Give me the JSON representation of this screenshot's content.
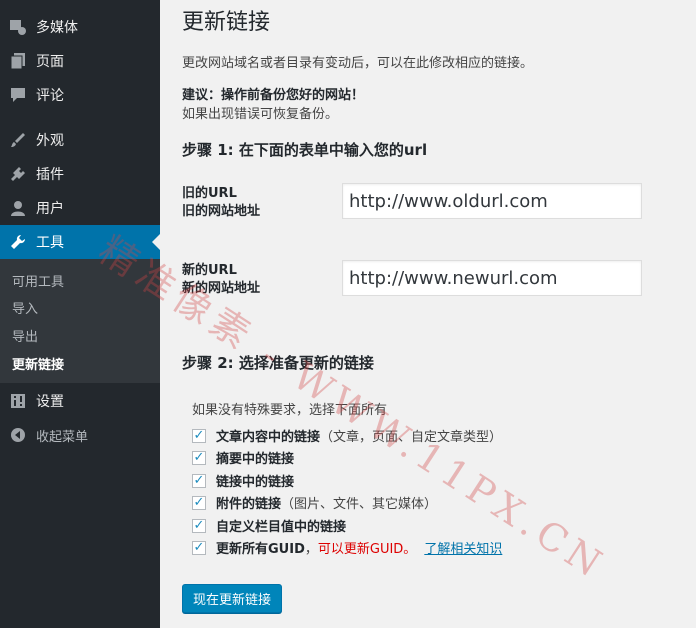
{
  "sidebar": {
    "items": [
      {
        "label": "多媒体",
        "icon": "media-icon"
      },
      {
        "label": "页面",
        "icon": "pages-icon"
      },
      {
        "label": "评论",
        "icon": "comments-icon"
      },
      {
        "label": "外观",
        "icon": "appearance-icon"
      },
      {
        "label": "插件",
        "icon": "plugins-icon"
      },
      {
        "label": "用户",
        "icon": "users-icon"
      },
      {
        "label": "工具",
        "icon": "tools-icon"
      }
    ],
    "submenu": [
      "可用工具",
      "导入",
      "导出",
      "更新链接"
    ],
    "bottom": [
      {
        "label": "设置",
        "icon": "settings-icon"
      },
      {
        "label": "收起菜单",
        "icon": "collapse-icon"
      }
    ]
  },
  "main": {
    "title": "更新链接",
    "description": "更改网站域名或者目录有变动后，可以在此修改相应的链接。",
    "suggestion": "建议：操作前备份您好的网站！",
    "suggestion_note": "如果出现错误可恢复备份。",
    "step1": "步骤 1: 在下面的表单中输入您的url",
    "old_label_1": "旧的URL",
    "old_label_2": "旧的网站地址",
    "old_value": "http://www.oldurl.com",
    "new_label_1": "新的URL",
    "new_label_2": "新的网站地址",
    "new_value": "http://www.newurl.com",
    "step2": "步骤 2: 选择准备更新的链接",
    "step2_note": "如果没有特殊要求，选择下面所有",
    "options": [
      {
        "bold": "文章内容中的链接",
        "rest": "（文章，页面、自定文章类型）"
      },
      {
        "bold": "摘要中的链接",
        "rest": ""
      },
      {
        "bold": "链接中的链接",
        "rest": ""
      },
      {
        "bold": "附件的链接",
        "rest": "（图片、文件、其它媒体）"
      },
      {
        "bold": "自定义栏目值中的链接",
        "rest": ""
      },
      {
        "bold": "更新所有GUID",
        "rest": "，"
      }
    ],
    "guid_warning": "可以更新GUID。",
    "learn_more": "了解相关知识",
    "submit": "现在更新链接"
  },
  "watermark": "精准像素 - WWW.11PX.CN"
}
